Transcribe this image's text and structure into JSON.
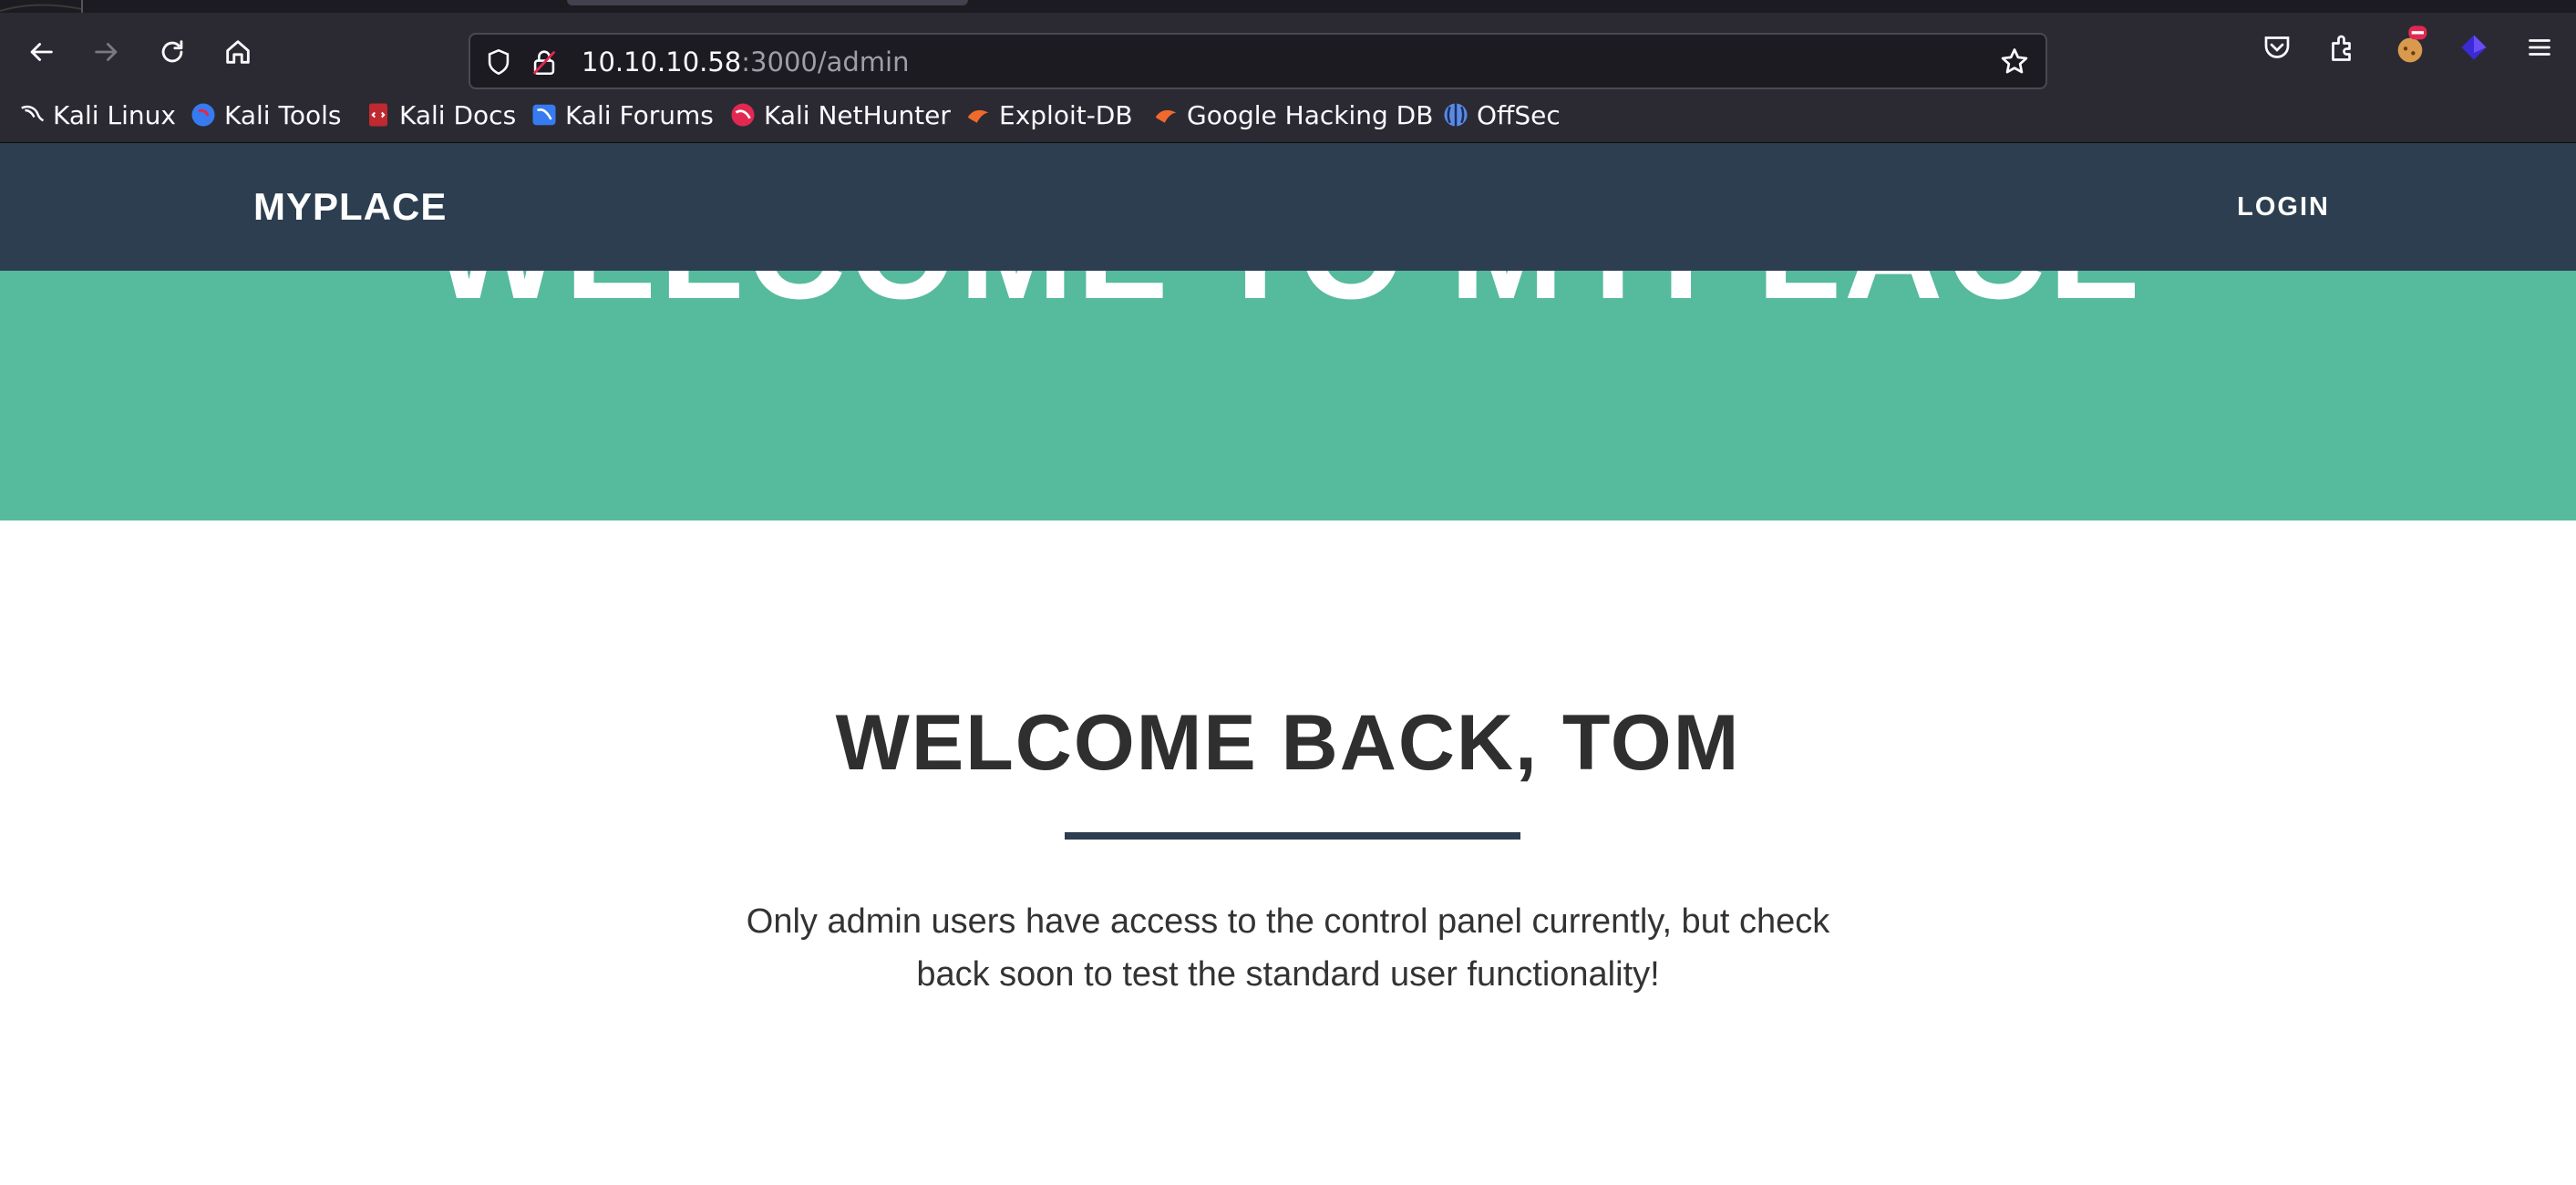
{
  "browser": {
    "url_host": "10.10.10.58",
    "url_path": ":3000/admin",
    "bookmarks": [
      {
        "label": "Kali Linux",
        "icon": "kali-dragon-icon"
      },
      {
        "label": "Kali Tools",
        "icon": "kali-tools-icon"
      },
      {
        "label": "Kali Docs",
        "icon": "kali-docs-icon"
      },
      {
        "label": "Kali Forums",
        "icon": "kali-forums-icon"
      },
      {
        "label": "Kali NetHunter",
        "icon": "kali-nethunter-icon"
      },
      {
        "label": "Exploit-DB",
        "icon": "exploit-db-icon"
      },
      {
        "label": "Google Hacking DB",
        "icon": "google-hacking-db-icon"
      },
      {
        "label": "OffSec",
        "icon": "offsec-icon"
      }
    ]
  },
  "site": {
    "brand": "MYPLACE",
    "login_label": "LOGIN",
    "hero_title": "WELCOME TO MYPLACE",
    "heading": "WELCOME BACK, TOM",
    "message": "Only admin users have access to the control panel currently, but check back soon to test the standard user functionality!"
  },
  "colors": {
    "header_bg": "#2c3e50",
    "hero_bg": "#56ba9d",
    "chrome_bg": "#2b2a33"
  }
}
